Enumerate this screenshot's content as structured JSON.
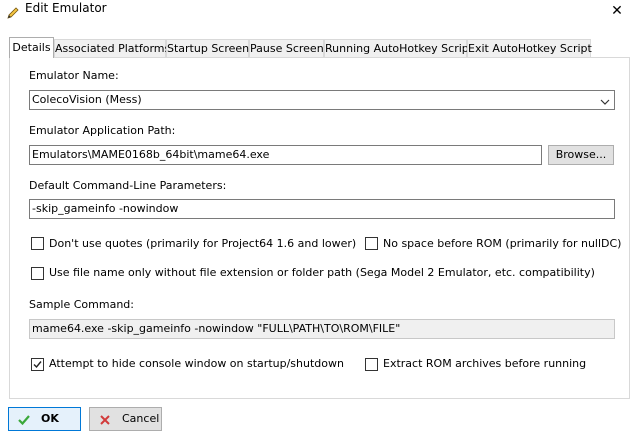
{
  "window": {
    "title": "Edit Emulator",
    "title_icon": "pencil-icon",
    "close_glyph": "✕"
  },
  "tabs": [
    {
      "label": "Details",
      "active": true
    },
    {
      "label": "Associated Platforms",
      "active": false
    },
    {
      "label": "Startup Screen",
      "active": false
    },
    {
      "label": "Pause Screen",
      "active": false
    },
    {
      "label": "Running AutoHotkey Script",
      "active": false
    },
    {
      "label": "Exit AutoHotkey Script",
      "active": false
    }
  ],
  "details": {
    "emulator_name_label": "Emulator Name:",
    "emulator_name_value": "ColecoVision (Mess)",
    "app_path_label": "Emulator Application Path:",
    "app_path_value": "Emulators\\MAME0168b_64bit\\mame64.exe",
    "browse_label": "Browse...",
    "cmdline_label": "Default Command-Line Parameters:",
    "cmdline_value": "-skip_gameinfo -nowindow",
    "dont_use_quotes_label": "Don't use quotes (primarily for Project64 1.6 and lower)",
    "dont_use_quotes_checked": false,
    "no_space_label": "No space before ROM (primarily for nullDC)",
    "no_space_checked": false,
    "use_filename_label": "Use file name only without file extension or folder path (Sega Model 2 Emulator, etc. compatibility)",
    "use_filename_checked": false,
    "sample_command_label": "Sample Command:",
    "sample_command_value": "mame64.exe -skip_gameinfo -nowindow \"FULL\\PATH\\TO\\ROM\\FILE\"",
    "hide_console_label": "Attempt to hide console window on startup/shutdown",
    "hide_console_checked": true,
    "extract_rom_label": "Extract ROM archives before running",
    "extract_rom_checked": false
  },
  "footer": {
    "ok_label": "OK",
    "cancel_label": "Cancel"
  },
  "colors": {
    "ok_icon": "#3aa83a",
    "cancel_icon": "#d23b3b",
    "focus_border": "#0078d7"
  }
}
